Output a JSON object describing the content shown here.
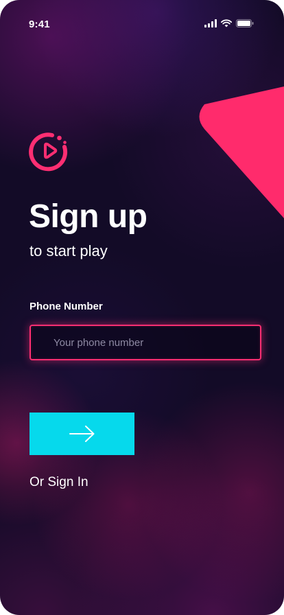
{
  "status_bar": {
    "time": "9:41",
    "icons": [
      "signal-icon",
      "wifi-icon",
      "battery-icon"
    ]
  },
  "logo": {
    "icon": "play-circle-icon",
    "color": "#ff2e72"
  },
  "header": {
    "title": "Sign up",
    "subtitle": "to start play"
  },
  "form": {
    "phone_label": "Phone Number",
    "phone_placeholder": "Your phone number",
    "phone_value": ""
  },
  "actions": {
    "submit_icon": "arrow-right-icon",
    "signin_link": "Or Sign In"
  },
  "colors": {
    "background": "#130b27",
    "accent_pink": "#ff2e72",
    "accent_cyan": "#06d9ec",
    "text": "#ffffff",
    "placeholder": "#8e8aa3"
  }
}
